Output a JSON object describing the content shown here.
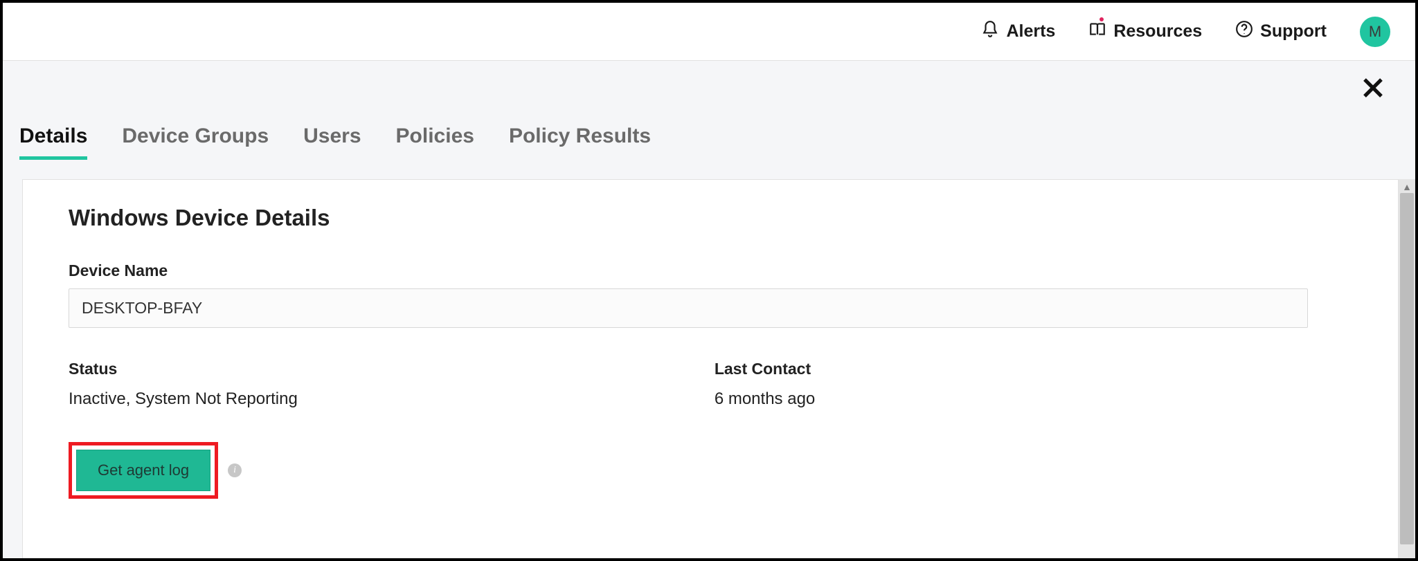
{
  "topbar": {
    "alerts_label": "Alerts",
    "resources_label": "Resources",
    "support_label": "Support",
    "avatar_initial": "M"
  },
  "tabs": [
    {
      "id": "details",
      "label": "Details",
      "active": true
    },
    {
      "id": "device-groups",
      "label": "Device Groups",
      "active": false
    },
    {
      "id": "users",
      "label": "Users",
      "active": false
    },
    {
      "id": "policies",
      "label": "Policies",
      "active": false
    },
    {
      "id": "policy-results",
      "label": "Policy Results",
      "active": false
    }
  ],
  "card": {
    "title": "Windows Device Details",
    "device_name_label": "Device Name",
    "device_name_value": "DESKTOP-BFAY",
    "status_label": "Status",
    "status_value": "Inactive, System Not Reporting",
    "last_contact_label": "Last Contact",
    "last_contact_value": "6 months ago",
    "get_agent_log_label": "Get agent log",
    "get_agent_log_highlighted": true
  }
}
